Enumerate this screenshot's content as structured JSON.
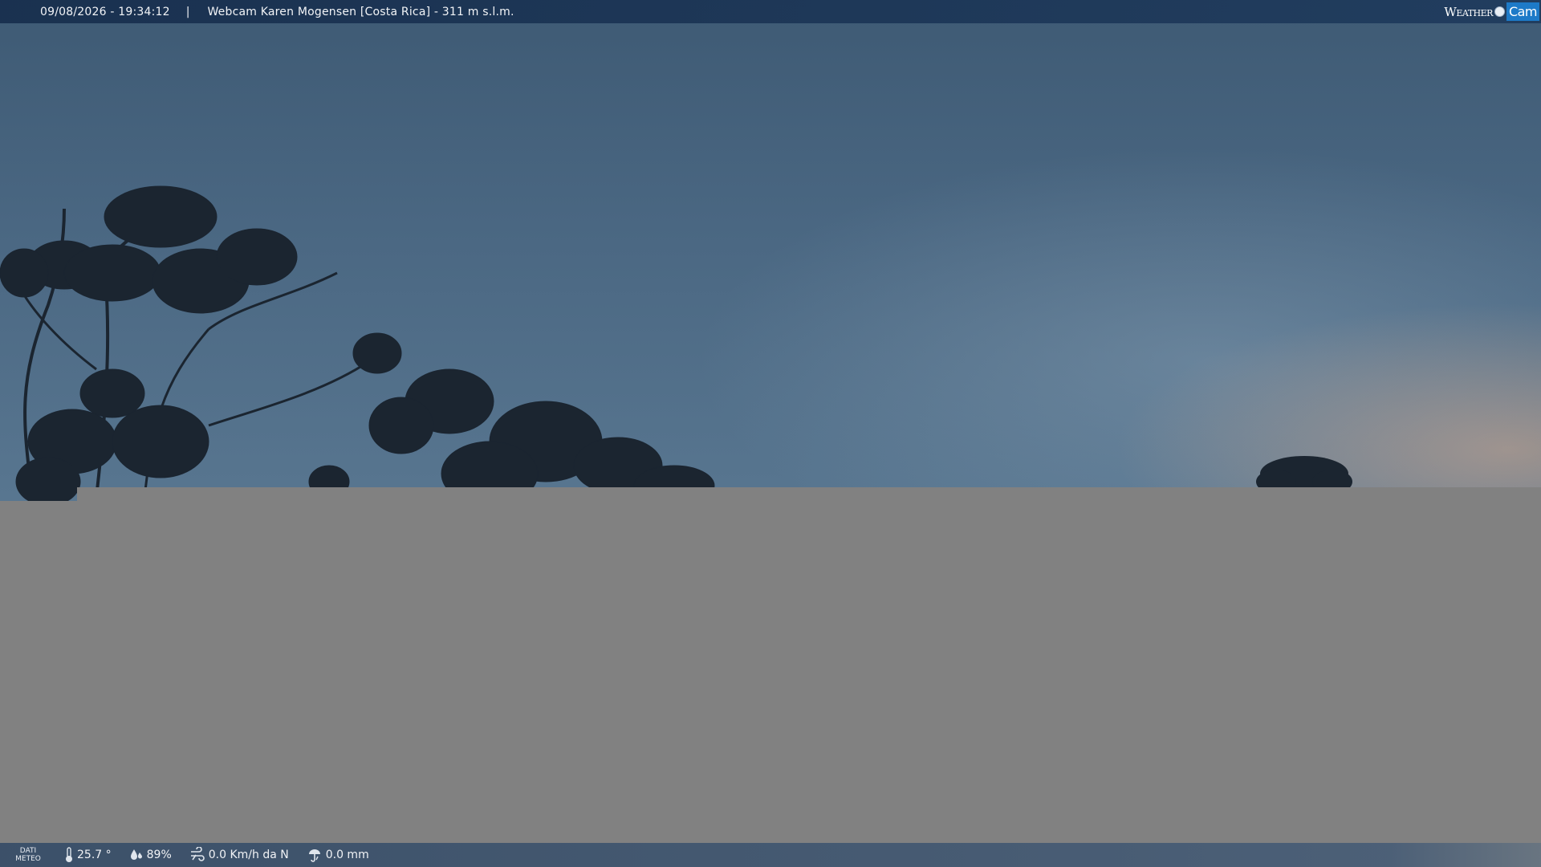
{
  "header": {
    "datetime": "09/08/2026 - 19:34:12",
    "separator": "|",
    "title": "Webcam Karen Mogensen [Costa Rica]  - 311 m s.l.m.",
    "brand": {
      "weather": "Weather",
      "cam": "Cam"
    }
  },
  "footer": {
    "label_line1": "DATI",
    "label_line2": "METEO",
    "temperature": "25.7 °",
    "humidity": "89%",
    "wind": "0.0 Km/h da N",
    "rain": "0.0 mm"
  },
  "icons": [
    "thermometer-icon",
    "humidity-drop-icon",
    "wind-icon",
    "rain-gauge-icon",
    "weathercam-logo-icon"
  ],
  "colors": {
    "topbar": "#1e3a5c",
    "bottombar": "#3f5875",
    "sky": "#4a6782",
    "brand_accent": "#1d7ac8",
    "gray_overlay": "#818181"
  }
}
